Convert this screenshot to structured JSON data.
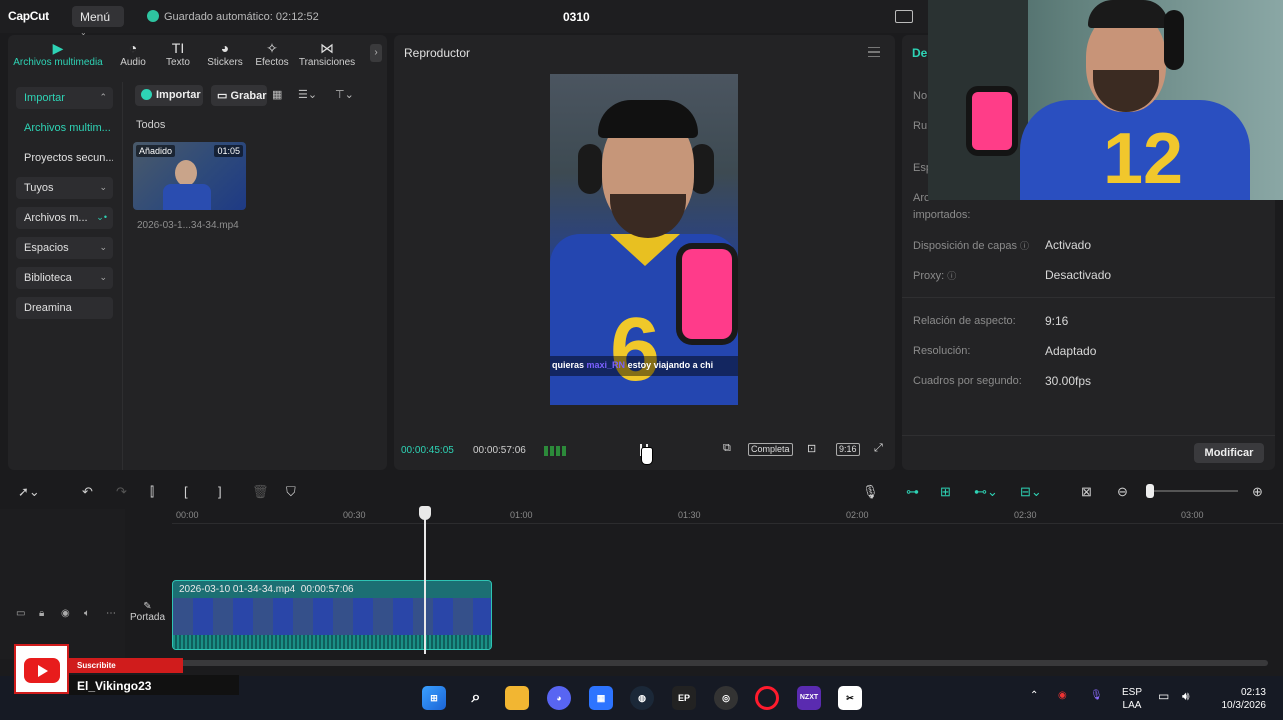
{
  "app": {
    "logo": "CapCut",
    "menu_label": "Menú",
    "autosave": "Guardado automático: 02:12:52",
    "project_title": "0310"
  },
  "media_tabs": [
    {
      "icon": "media-icon",
      "glyph": "▶",
      "label": "Archivos multimedia"
    },
    {
      "icon": "audio-icon",
      "glyph": "◔",
      "label": "Audio"
    },
    {
      "icon": "text-icon",
      "glyph": "TI",
      "label": "Texto"
    },
    {
      "icon": "stickers-icon",
      "glyph": "◕",
      "label": "Stickers"
    },
    {
      "icon": "effects-icon",
      "glyph": "✧",
      "label": "Efectos"
    },
    {
      "icon": "transitions-icon",
      "glyph": "⋈",
      "label": "Transiciones"
    }
  ],
  "sidebar": {
    "items": [
      {
        "label": "Importar"
      },
      {
        "label": "Archivos multim..."
      },
      {
        "label": "Proyectos secun..."
      },
      {
        "label": "Tuyos"
      },
      {
        "label": "Archivos m..."
      },
      {
        "label": "Espacios"
      },
      {
        "label": "Biblioteca"
      },
      {
        "label": "Dreamina"
      }
    ]
  },
  "media": {
    "import_label": "Importar",
    "record_label": "Grabar",
    "filter_label": "Todos",
    "thumb_tag": "Añadido",
    "thumb_duration": "01:05",
    "thumb_name": "2026-03-1...34-34.mp4"
  },
  "player": {
    "title": "Reproductor",
    "chat_text": "quieras",
    "chat_user": "maxi_RN",
    "chat_msg": "estoy viajando a chi",
    "current_time": "00:00:45:05",
    "total_time": "00:00:57:06",
    "full_label": "Completa",
    "ratio_label": "9:16"
  },
  "details": {
    "tab_partial": "De",
    "row_partials": [
      "No",
      "Ru",
      "Esp",
      "Arc"
    ],
    "imported_label": "importados:",
    "rows": [
      {
        "label": "Disposición de capas",
        "value": "Activado"
      },
      {
        "label": "Proxy:",
        "value": "Desactivado"
      },
      {
        "label": "Relación de aspecto:",
        "value": "9:16"
      },
      {
        "label": "Resolución:",
        "value": "Adaptado"
      },
      {
        "label": "Cuadros por segundo:",
        "value": "30.00fps"
      }
    ],
    "modify_label": "Modificar"
  },
  "timeline": {
    "ticks": [
      "00:00",
      "00:30",
      "01:00",
      "01:30",
      "02:00",
      "02:30",
      "03:00"
    ],
    "clip_name": "2026-03-10 01-34-34.mp4",
    "clip_duration": "00:00:57:06",
    "cover_label": "Portada"
  },
  "overlay": {
    "subscribe": "Suscribite",
    "channel": "El_Vikingo23"
  },
  "taskbar": {
    "lang1": "ESP",
    "lang2": "LAA",
    "time": "02:13",
    "date": "10/3/2026"
  },
  "colors": {
    "accent": "#2ed3b5",
    "panel": "#232325",
    "youtube": "#e81c1c"
  }
}
